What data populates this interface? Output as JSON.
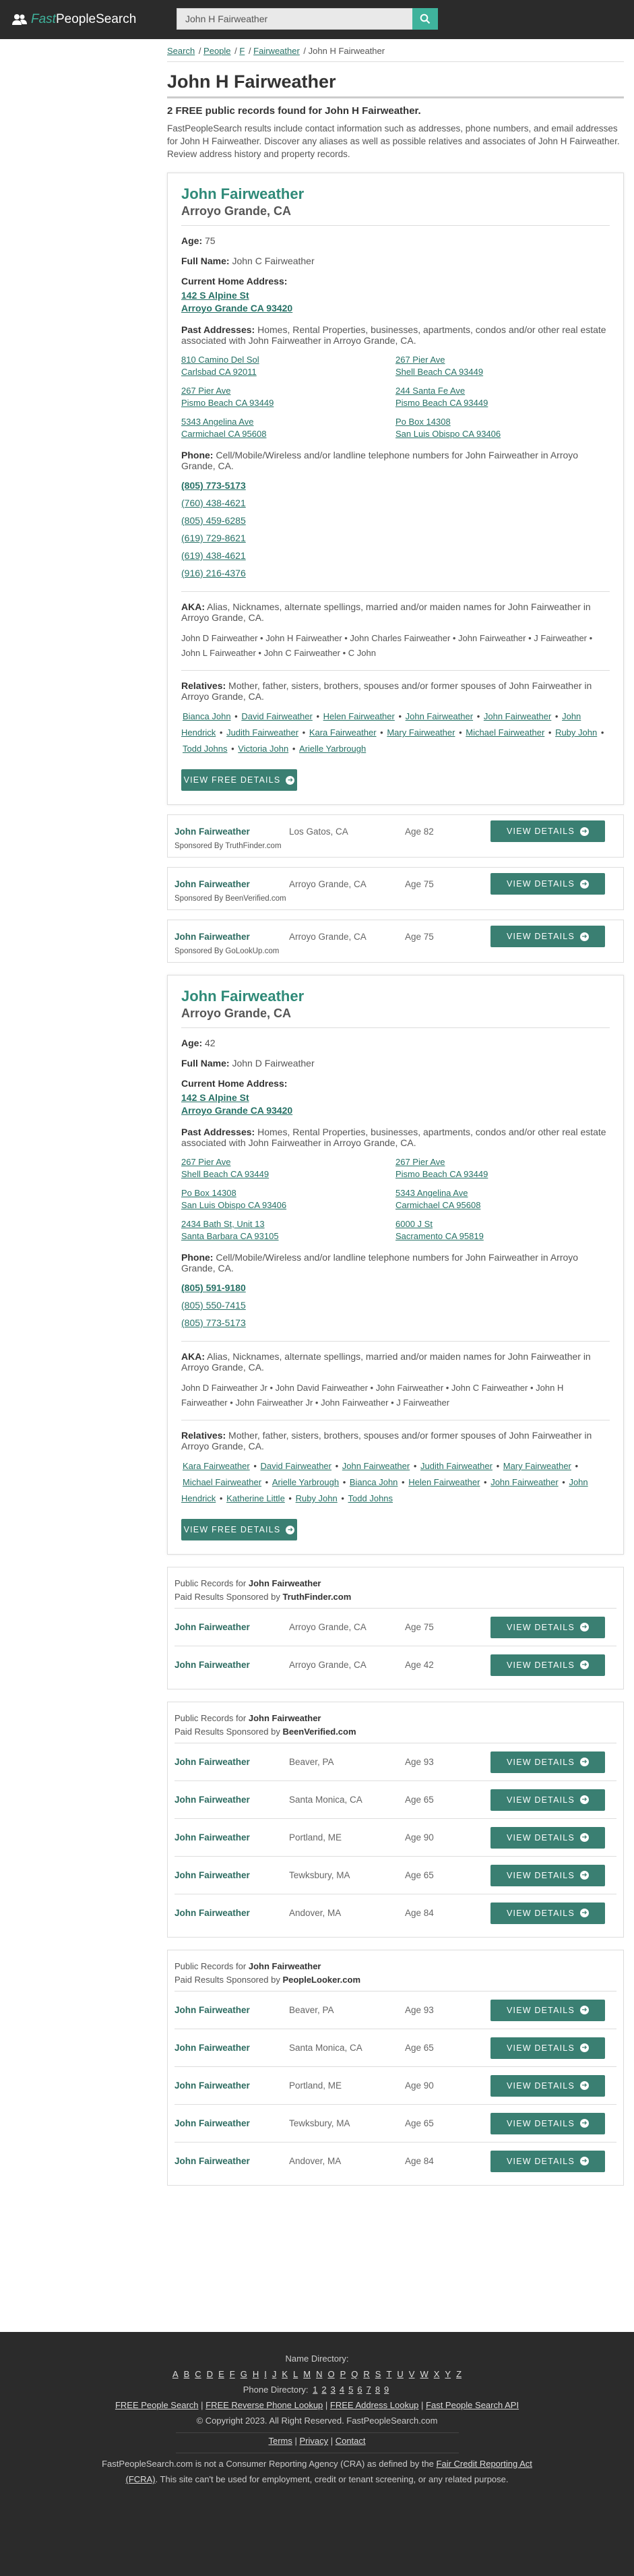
{
  "brand": {
    "fast": "Fast",
    "rest": "PeopleSearch"
  },
  "search": {
    "value": "John H Fairweather"
  },
  "breadcrumb": {
    "search": "Search",
    "people": "People",
    "letter": "F",
    "surname": "Fairweather",
    "current": "John H Fairweather"
  },
  "page_title": "John H Fairweather",
  "intro_strong": "2 FREE public records found for John H Fairweather.",
  "intro": "FastPeopleSearch results include contact information such as addresses, phone numbers, and email addresses for John H Fairweather. Discover any aliases as well as possible relatives and associates of John H Fairweather. Review address history and property records.",
  "labels": {
    "age": "Age:",
    "full_name": "Full Name:",
    "current_address": "Current Home Address:",
    "past_addresses": "Past Addresses:",
    "phone": "Phone:",
    "aka": "AKA:",
    "relatives": "Relatives:",
    "view_free_details": "VIEW FREE DETAILS",
    "view_details": "VIEW DETAILS"
  },
  "records": [
    {
      "name": "John Fairweather",
      "location": "Arroyo Grande, CA",
      "age": "75",
      "full_name": "John C Fairweather",
      "current_address_1": "142 S Alpine St",
      "current_address_2": "Arroyo Grande CA 93420",
      "past_addresses_desc": "Homes, Rental Properties, businesses, apartments, condos and/or other real estate associated with John Fairweather in Arroyo Grande, CA.",
      "past_addresses": [
        {
          "line1": "810 Camino Del Sol",
          "line2": "Carlsbad CA 92011"
        },
        {
          "line1": "267 Pier Ave",
          "line2": "Shell Beach CA 93449"
        },
        {
          "line1": "267 Pier Ave",
          "line2": "Pismo Beach CA 93449"
        },
        {
          "line1": "244 Santa Fe Ave",
          "line2": "Pismo Beach CA 93449"
        },
        {
          "line1": "5343 Angelina Ave",
          "line2": "Carmichael CA 95608"
        },
        {
          "line1": "Po Box 14308",
          "line2": "San Luis Obispo CA 93406"
        }
      ],
      "phone_desc": "Cell/Mobile/Wireless and/or landline telephone numbers for John Fairweather in Arroyo Grande, CA.",
      "phones": [
        "(805) 773-5173",
        "(760) 438-4621",
        "(805) 459-6285",
        "(619) 729-8621",
        "(619) 438-4621",
        "(916) 216-4376"
      ],
      "aka_desc": "Alias, Nicknames, alternate spellings, married and/or maiden names for John Fairweather in Arroyo Grande, CA.",
      "aka_list": "John D Fairweather • John H Fairweather • John Charles Fairweather • John Fairweather • J Fairweather • John L Fairweather • John C Fairweather • C John",
      "relatives_desc": "Mother, father, sisters, brothers, spouses and/or former spouses of John Fairweather in Arroyo Grande, CA.",
      "relatives": [
        "Bianca John",
        "David Fairweather",
        "Helen Fairweather",
        "John Fairweather",
        "John Fairweather",
        "John Hendrick",
        "Judith Fairweather",
        "Kara Fairweather",
        "Mary Fairweather",
        "Michael Fairweather",
        "Ruby John",
        "Todd Johns",
        "Victoria John",
        "Arielle Yarbrough"
      ]
    },
    {
      "name": "John Fairweather",
      "location": "Arroyo Grande, CA",
      "age": "42",
      "full_name": "John D Fairweather",
      "current_address_1": "142 S Alpine St",
      "current_address_2": "Arroyo Grande CA 93420",
      "past_addresses_desc": "Homes, Rental Properties, businesses, apartments, condos and/or other real estate associated with John Fairweather in Arroyo Grande, CA.",
      "past_addresses": [
        {
          "line1": "267 Pier Ave",
          "line2": "Shell Beach CA 93449"
        },
        {
          "line1": "267 Pier Ave",
          "line2": "Pismo Beach CA 93449"
        },
        {
          "line1": "Po Box 14308",
          "line2": "San Luis Obispo CA 93406"
        },
        {
          "line1": "5343 Angelina Ave",
          "line2": "Carmichael CA 95608"
        },
        {
          "line1": "2434 Bath St, Unit 13",
          "line2": "Santa Barbara CA 93105"
        },
        {
          "line1": "6000 J St",
          "line2": "Sacramento CA 95819"
        }
      ],
      "phone_desc": "Cell/Mobile/Wireless and/or landline telephone numbers for John Fairweather in Arroyo Grande, CA.",
      "phones": [
        "(805) 591-9180",
        "(805) 550-7415",
        "(805) 773-5173"
      ],
      "aka_desc": "Alias, Nicknames, alternate spellings, married and/or maiden names for John Fairweather in Arroyo Grande, CA.",
      "aka_list": "John D Fairweather Jr • John David Fairweather • John Fairweather • John C Fairweather • John H Fairweather • John Fairweather Jr • John Fairweather • J Fairweather",
      "relatives_desc": "Mother, father, sisters, brothers, spouses and/or former spouses of John Fairweather in Arroyo Grande, CA.",
      "relatives": [
        "Kara Fairweather",
        "David Fairweather",
        "John Fairweather",
        "Judith Fairweather",
        "Mary Fairweather",
        "Michael Fairweather",
        "Arielle Yarbrough",
        "Bianca John",
        "Helen Fairweather",
        "John Fairweather",
        "John Hendrick",
        "Katherine Little",
        "Ruby John",
        "Todd Johns"
      ]
    }
  ],
  "sponsored_single": [
    {
      "name": "John Fairweather",
      "city": "Los Gatos, CA",
      "age": "Age 82",
      "sponsor": "Sponsored By TruthFinder.com"
    },
    {
      "name": "John Fairweather",
      "city": "Arroyo Grande, CA",
      "age": "Age 75",
      "sponsor": "Sponsored By BeenVerified.com"
    },
    {
      "name": "John Fairweather",
      "city": "Arroyo Grande, CA",
      "age": "Age 75",
      "sponsor": "Sponsored By GoLookUp.com"
    }
  ],
  "public_boxes": [
    {
      "title_prefix": "Public Records for",
      "title_name": "John Fairweather",
      "paid_prefix": "Paid Results Sponsored by",
      "sponsor": "TruthFinder.com",
      "rows": [
        {
          "name": "John Fairweather",
          "city": "Arroyo Grande, CA",
          "age": "Age 75"
        },
        {
          "name": "John Fairweather",
          "city": "Arroyo Grande, CA",
          "age": "Age 42"
        }
      ]
    },
    {
      "title_prefix": "Public Records for",
      "title_name": "John Fairweather",
      "paid_prefix": "Paid Results Sponsored by",
      "sponsor": "BeenVerified.com",
      "rows": [
        {
          "name": "John Fairweather",
          "city": "Beaver, PA",
          "age": "Age 93"
        },
        {
          "name": "John Fairweather",
          "city": "Santa Monica, CA",
          "age": "Age 65"
        },
        {
          "name": "John Fairweather",
          "city": "Portland, ME",
          "age": "Age 90"
        },
        {
          "name": "John Fairweather",
          "city": "Tewksbury, MA",
          "age": "Age 65"
        },
        {
          "name": "John Fairweather",
          "city": "Andover, MA",
          "age": "Age 84"
        }
      ]
    },
    {
      "title_prefix": "Public Records for",
      "title_name": "John Fairweather",
      "paid_prefix": "Paid Results Sponsored by",
      "sponsor": "PeopleLooker.com",
      "rows": [
        {
          "name": "John Fairweather",
          "city": "Beaver, PA",
          "age": "Age 93"
        },
        {
          "name": "John Fairweather",
          "city": "Santa Monica, CA",
          "age": "Age 65"
        },
        {
          "name": "John Fairweather",
          "city": "Portland, ME",
          "age": "Age 90"
        },
        {
          "name": "John Fairweather",
          "city": "Tewksbury, MA",
          "age": "Age 65"
        },
        {
          "name": "John Fairweather",
          "city": "Andover, MA",
          "age": "Age 84"
        }
      ]
    }
  ],
  "footer": {
    "name_directory": "Name Directory:",
    "letters": [
      "A",
      "B",
      "C",
      "D",
      "E",
      "F",
      "G",
      "H",
      "I",
      "J",
      "K",
      "L",
      "M",
      "N",
      "O",
      "P",
      "Q",
      "R",
      "S",
      "T",
      "U",
      "V",
      "W",
      "X",
      "Y",
      "Z"
    ],
    "phone_directory": "Phone Directory:",
    "pages": [
      "1",
      "2",
      "3",
      "4",
      "5",
      "6",
      "7",
      "8",
      "9"
    ],
    "links": [
      "FREE People Search",
      "FREE Reverse Phone Lookup",
      "FREE Address Lookup",
      "Fast People Search API"
    ],
    "copyright": "© Copyright 2023. All Right Reserved. FastPeopleSearch.com",
    "legal_links": [
      "Terms",
      "Privacy",
      "Contact"
    ],
    "disclaimer_1": "FastPeopleSearch.com is not a Consumer Reporting Agency (CRA) as defined by the",
    "fcra_link": "Fair Credit Reporting Act (FCRA)",
    "disclaimer_2": ". This site can't be used for employment, credit or tenant screening, or any related purpose."
  },
  "colors": {
    "accent": "#3fb39c",
    "button": "#3a7f72",
    "header_bg": "#2b2b2b",
    "link": "#267166"
  }
}
